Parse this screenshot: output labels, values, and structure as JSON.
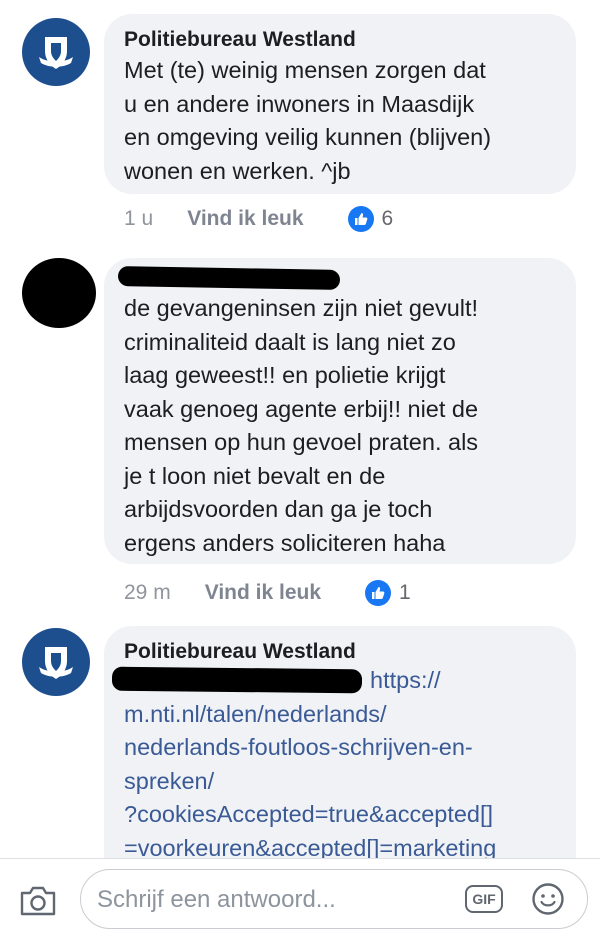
{
  "comments": [
    {
      "author": "Politiebureau Westland",
      "text": "Met (te) weinig mensen zorgen dat\nu en andere inwoners in Maasdijk\nen omgeving veilig kunnen (blijven)\nwonen en werken. ^jb",
      "time": "1 u",
      "like_label": "Vind ik leuk",
      "reaction_count": "6"
    },
    {
      "author": "",
      "text": "de gevangeninsen zijn niet gevult!\ncriminaliteid daalt is lang niet zo\nlaag geweest!! en polietie krijgt\nvaak genoeg agente erbij!! niet de\nmensen op hun gevoel praten. als\nje t loon niet bevalt en de\narbijdsvoorden dan ga je toch\nergens anders soliciteren haha",
      "time": "29 m",
      "like_label": "Vind ik leuk",
      "reaction_count": "1"
    },
    {
      "author": "Politiebureau Westland",
      "link_text": "https://\nm.nti.nl/talen/nederlands/\nnederlands-foutloos-schrijven-en-\nspreken/\n?cookiesAccepted=true&accepted[]\n=voorkeuren&accepted[]=marketing"
    }
  ],
  "composer": {
    "placeholder": "Schrijf een antwoord...",
    "gif_label": "GIF"
  },
  "colors": {
    "brand_blue": "#1d4f8f",
    "like_blue": "#1877f2",
    "link": "#3a5a96",
    "bubble": "#f0f2f5"
  },
  "icons": [
    "police-logo-icon",
    "like-thumb-icon",
    "camera-icon",
    "gif-icon",
    "emoji-icon"
  ]
}
